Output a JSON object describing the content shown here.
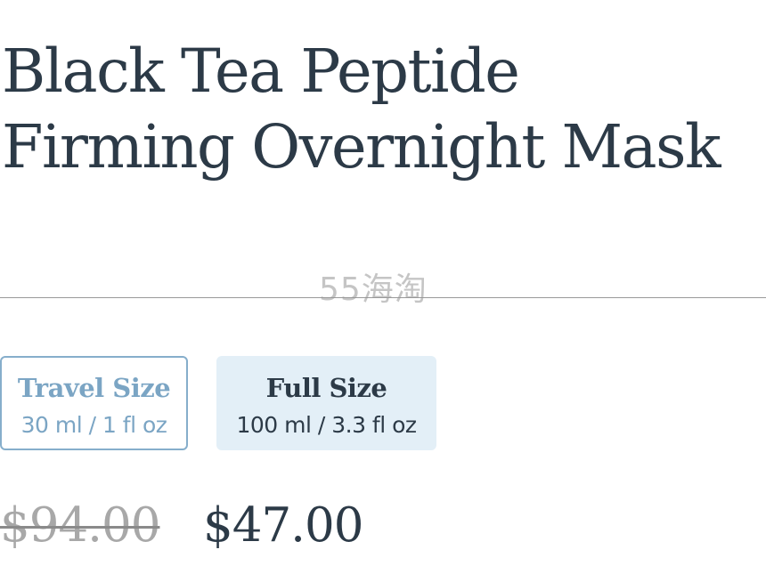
{
  "product": {
    "title": "Black Tea Peptide Firming Overnight Mask"
  },
  "watermark": {
    "text": "55海淘"
  },
  "size_options": [
    {
      "name": "Travel Size",
      "volume": "30 ml / 1 fl oz",
      "selected": false
    },
    {
      "name": "Full Size",
      "volume": "100 ml / 3.3 fl oz",
      "selected": true
    }
  ],
  "price": {
    "original": "$94.00",
    "current": "$47.00"
  },
  "colors": {
    "text_primary": "#2c3a47",
    "option_accent": "#86aecb",
    "selected_bg": "#e3eff7",
    "strikethrough_text": "#a8a8a8"
  }
}
